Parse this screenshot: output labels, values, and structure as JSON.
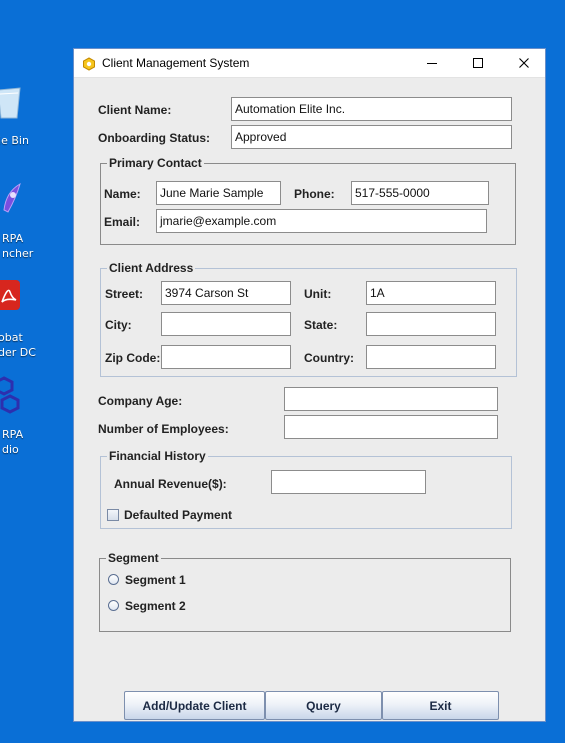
{
  "desktop": {
    "icons": [
      {
        "label": "cle Bin",
        "icon": "recycle-bin-icon"
      },
      {
        "label_line1": "RPA",
        "label_line2": "ncher",
        "icon": "rpa-launcher-icon"
      },
      {
        "label_line1": "obat",
        "label_line2": "der DC",
        "icon": "acrobat-reader-icon"
      },
      {
        "label_line1": "RPA",
        "label_line2": "dio",
        "icon": "rpa-studio-icon"
      }
    ]
  },
  "window": {
    "title": "Client Management System",
    "minimize_glyph": "—",
    "maximize_glyph": "☐",
    "close_glyph": "✕"
  },
  "form": {
    "client_name": {
      "label": "Client Name:",
      "value": "Automation Elite Inc."
    },
    "onboarding_status": {
      "label": "Onboarding Status:",
      "value": "Approved"
    },
    "primary_contact": {
      "title": "Primary Contact",
      "name": {
        "label": "Name:",
        "value": "June Marie Sample"
      },
      "phone": {
        "label": "Phone:",
        "value": "517-555-0000"
      },
      "email": {
        "label": "Email:",
        "value": "jmarie@example.com"
      }
    },
    "client_address": {
      "title": "Client Address",
      "street": {
        "label": "Street:",
        "value": "3974 Carson St"
      },
      "unit": {
        "label": "Unit:",
        "value": "1A"
      },
      "city": {
        "label": "City:",
        "value": ""
      },
      "state": {
        "label": "State:",
        "value": ""
      },
      "zip": {
        "label": "Zip Code:",
        "value": ""
      },
      "country": {
        "label": "Country:",
        "value": ""
      }
    },
    "company_age": {
      "label": "Company Age:",
      "value": ""
    },
    "num_employees": {
      "label": "Number of Employees:",
      "value": ""
    },
    "financial_history": {
      "title": "Financial History",
      "annual_revenue": {
        "label": "Annual Revenue($):",
        "value": ""
      },
      "defaulted_payment": {
        "label": "Defaulted Payment",
        "checked": false
      }
    },
    "segment": {
      "title": "Segment",
      "options": [
        {
          "label": "Segment 1",
          "selected": false
        },
        {
          "label": "Segment 2",
          "selected": false
        }
      ]
    }
  },
  "buttons": {
    "add_update": "Add/Update Client",
    "query": "Query",
    "exit": "Exit"
  },
  "colors": {
    "desktop": "#0a6fd6",
    "window_bg": "#ececec",
    "accent_border": "#6a8fc9"
  }
}
